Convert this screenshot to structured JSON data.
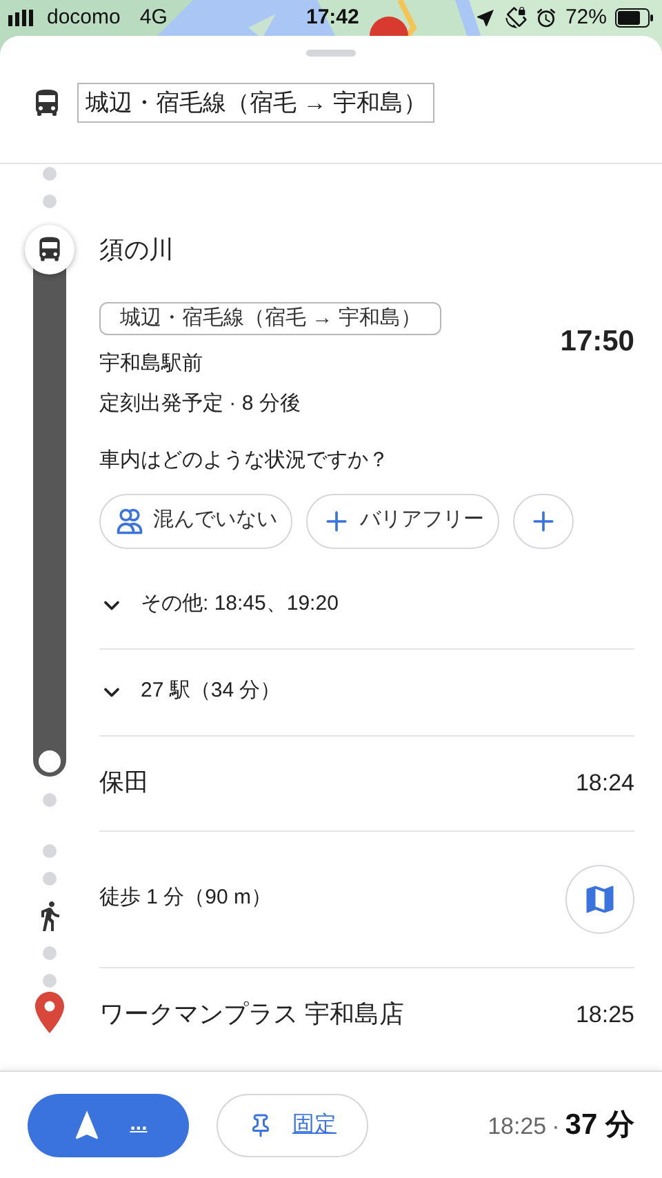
{
  "status_bar": {
    "carrier": "docomo",
    "network": "4G",
    "time": "17:42",
    "battery": "72%"
  },
  "route_header": {
    "line": "城辺・宿毛線（宿毛 → 宇和島）"
  },
  "departure": {
    "stop": "須の川",
    "line": "城辺・宿毛線（宿毛 → 宇和島）",
    "from": "宇和島駅前",
    "status": "定刻出発予定 · 8 分後",
    "time": "17:50",
    "question": "車内はどのような状況ですか？",
    "chips": [
      {
        "kind": "crowd",
        "label": "混んでいない"
      },
      {
        "kind": "add",
        "label": "バリアフリー"
      },
      {
        "kind": "add"
      }
    ]
  },
  "expanders": [
    {
      "label": "その他: 18:45、19:20",
      "expanded": false
    },
    {
      "label": "27 駅（34 分）",
      "expanded": false
    }
  ],
  "arrival": {
    "stop": "保田",
    "time": "18:24"
  },
  "walk": {
    "label": "徒歩 1 分（90 m）"
  },
  "destination": {
    "name": "ワークマンプラス 宇和島店",
    "time": "18:25"
  },
  "bottom_bar": {
    "start_label": "...",
    "pin_label": "固定",
    "arrival": "18:25",
    "separator": "·",
    "duration": "37 分"
  }
}
